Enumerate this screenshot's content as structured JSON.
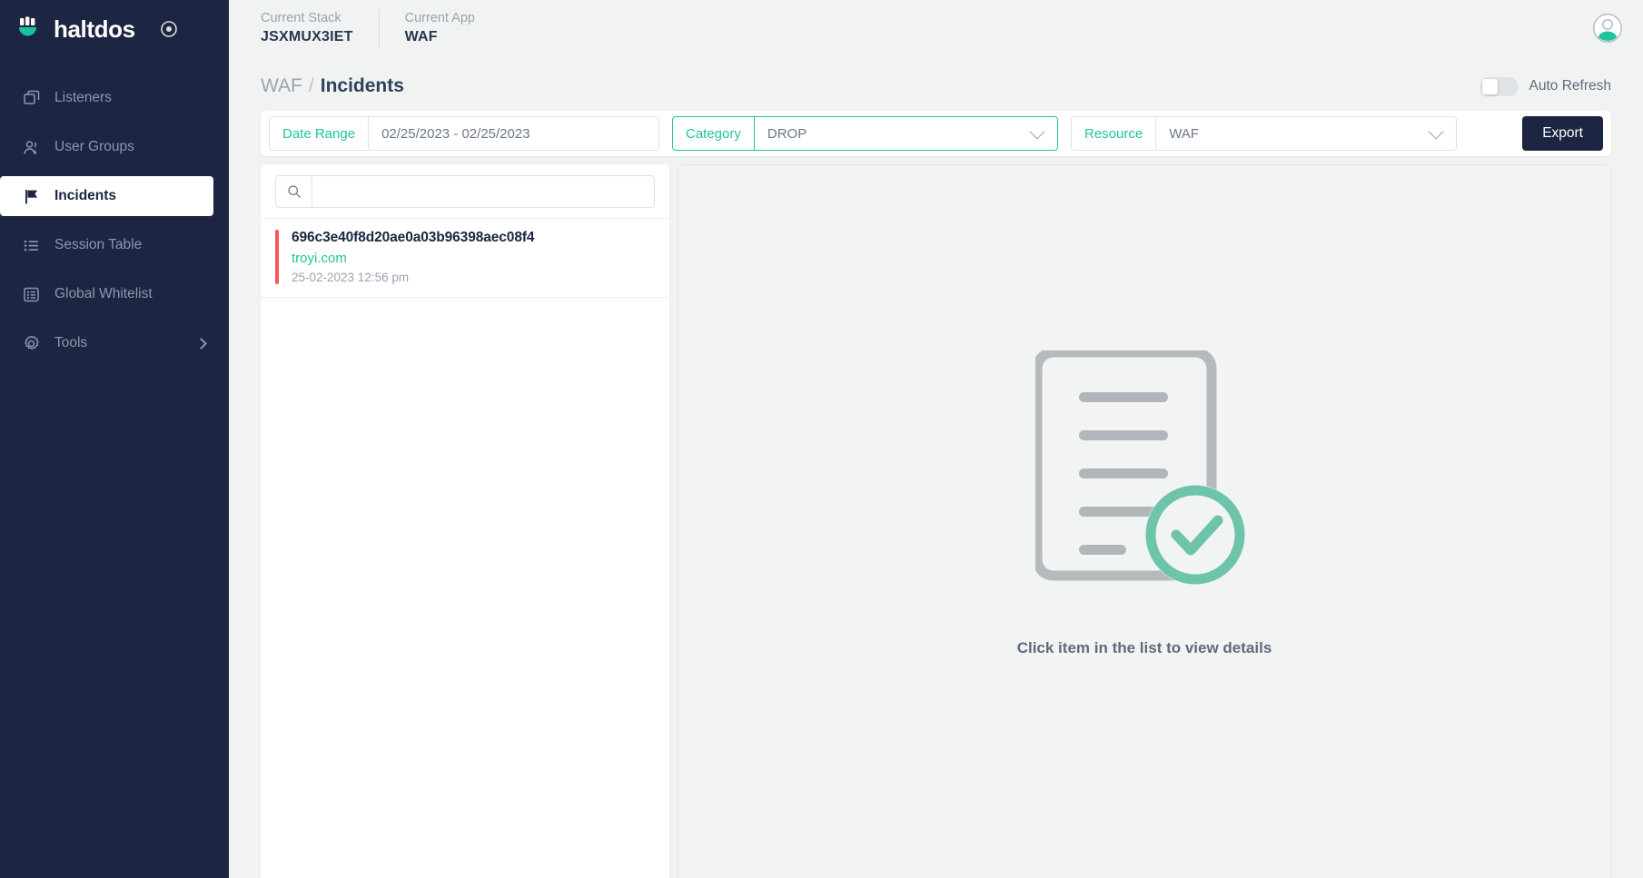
{
  "brand": {
    "name": "haltdos",
    "logo_icon": "haltdos-logo-icon",
    "target_icon": "target-icon"
  },
  "sidebar": {
    "items": [
      {
        "label": "Listeners",
        "icon": "window-stack-icon",
        "active": false
      },
      {
        "label": "User Groups",
        "icon": "users-icon",
        "active": false
      },
      {
        "label": "Incidents",
        "icon": "flag-icon",
        "active": true
      },
      {
        "label": "Session Table",
        "icon": "list-icon",
        "active": false
      },
      {
        "label": "Global Whitelist",
        "icon": "list-card-icon",
        "active": false
      },
      {
        "label": "Tools",
        "icon": "gear-icon",
        "active": false,
        "expandable": true
      }
    ]
  },
  "topbar": {
    "current_stack_label": "Current Stack",
    "current_stack_value": "JSXMUX3IET",
    "current_app_label": "Current App",
    "current_app_value": "WAF",
    "avatar_icon": "user-avatar-icon"
  },
  "page": {
    "breadcrumb_parent": "WAF",
    "breadcrumb_separator": "/",
    "breadcrumb_current": "Incidents",
    "auto_refresh_label": "Auto Refresh",
    "auto_refresh_on": false
  },
  "filters": {
    "date_range": {
      "label": "Date Range",
      "value": "02/25/2023 - 02/25/2023"
    },
    "category": {
      "label": "Category",
      "value": "DROP",
      "focused": true
    },
    "resource": {
      "label": "Resource",
      "value": "WAF"
    },
    "export_label": "Export"
  },
  "list": {
    "search_placeholder": "",
    "search_value": "",
    "search_icon": "search-icon",
    "items": [
      {
        "id": "696c3e40f8d20ae0a03b96398aec08f4",
        "host": "troyi.com",
        "timestamp": "25-02-2023 12:56 pm",
        "severity_color": "#f4565b"
      }
    ]
  },
  "detail": {
    "empty_text": "Click item in the list to view details",
    "empty_icon": "document-check-icon"
  },
  "colors": {
    "accent_teal": "#21c39a",
    "sidebar_navy": "#1c2541",
    "severity_red": "#f4565b"
  }
}
